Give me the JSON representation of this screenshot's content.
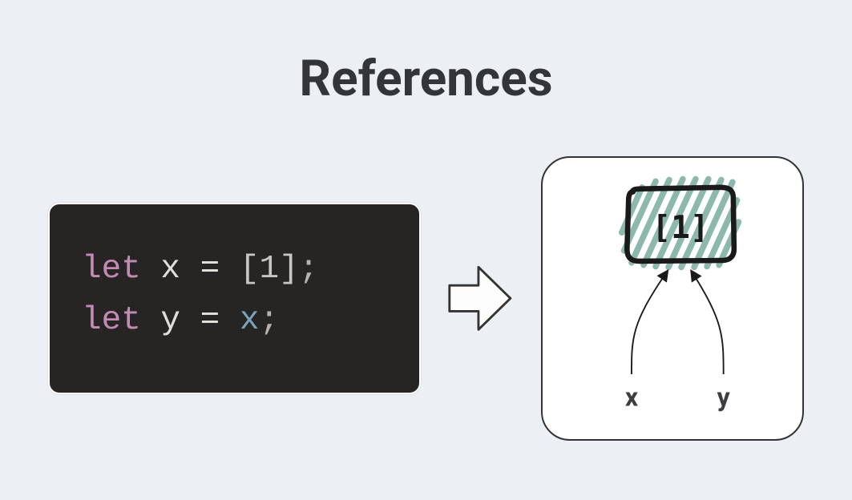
{
  "title": "References",
  "code": {
    "line1": {
      "keyword": "let",
      "var": "x",
      "eq": "=",
      "open": "[",
      "num": "1",
      "close": "]",
      "semi": ";"
    },
    "line2": {
      "keyword": "let",
      "var": "y",
      "eq": "=",
      "ref": "x",
      "semi": ";"
    }
  },
  "diagram": {
    "boxContent": "[1]",
    "varLeft": "x",
    "varRight": "y"
  },
  "colors": {
    "background": "#eceff4",
    "code_bg": "#272524",
    "keyword": "#c48ab6",
    "ref": "#7aa4bd",
    "hatch": "#8db8ad",
    "text": "#333538"
  }
}
